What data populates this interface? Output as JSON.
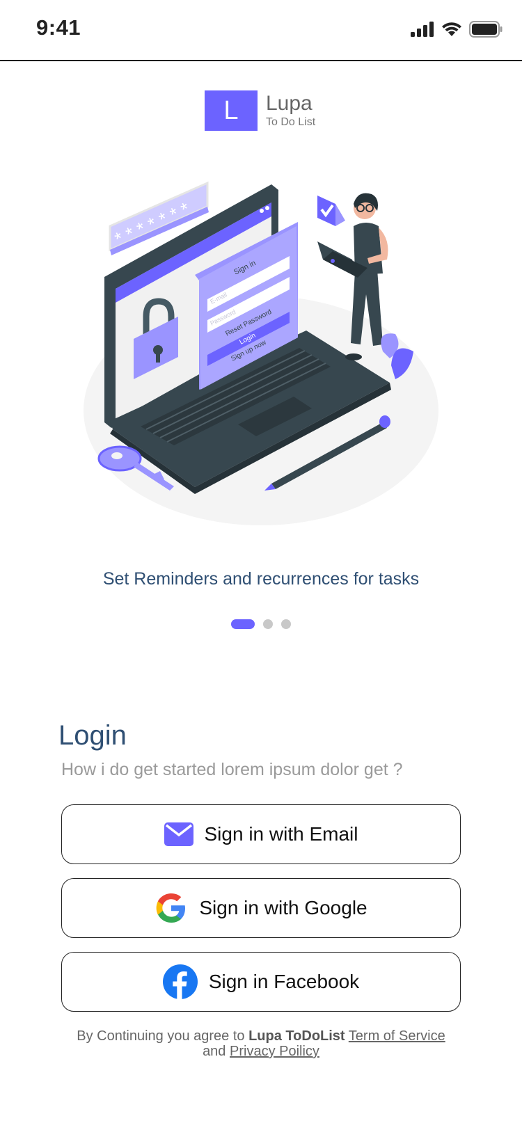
{
  "status_bar": {
    "time": "9:41"
  },
  "logo": {
    "letter": "L",
    "name": "Lupa",
    "tagline": "To Do List"
  },
  "illustration": {
    "password_stars": "* * * *   * * *",
    "form_title": "Sign in",
    "email_placeholder": "E-mail",
    "password_placeholder": "Password",
    "reset_label": "Reset Password",
    "login_label": "Login",
    "signup_label": "Sign up now"
  },
  "onboarding": {
    "caption": "Set Reminders and recurrences for tasks",
    "pages": 3,
    "active_page": 1
  },
  "login": {
    "title": "Login",
    "subtitle": "How i do get started lorem ipsum dolor get ?",
    "email_button": "Sign in with Email",
    "google_button": "Sign in with Google",
    "facebook_button": "Sign in Facebook"
  },
  "terms": {
    "prefix": "By Continuing you agree to",
    "brand": "Lupa ToDoList",
    "tos_link": "Term of Service",
    "and": "and",
    "privacy_link": "Privacy Poilicy"
  },
  "colors": {
    "accent": "#6c63ff",
    "title": "#2f4f73",
    "facebook": "#1877f2",
    "laptop": "#37474f"
  },
  "icons": [
    "signal-icon",
    "wifi-icon",
    "battery-icon",
    "mail-icon",
    "google-icon",
    "facebook-icon"
  ]
}
